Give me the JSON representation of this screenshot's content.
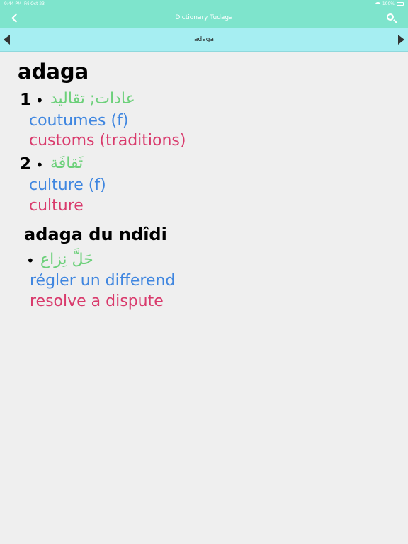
{
  "status_bar": {
    "time": "9:44 PM",
    "date": "Fri Oct 23",
    "battery": "100%"
  },
  "nav": {
    "title": "Dictionary Tudaga"
  },
  "sub_nav": {
    "title": "adaga"
  },
  "entry": {
    "headword": "adaga",
    "senses": [
      {
        "number": "1",
        "bullet": "•",
        "arabic": "عادات; تقاليد",
        "french": "coutumes (f)",
        "english": "customs (traditions)"
      },
      {
        "number": "2",
        "bullet": "•",
        "arabic": "ثَقافَة",
        "french": "culture (f)",
        "english": "culture"
      }
    ],
    "phrase": {
      "title": "adaga du ndîdi",
      "bullet": "•",
      "arabic": "حَلَّ نِزاع",
      "french": "régler un differend",
      "english": "resolve a dispute"
    }
  },
  "colors": {
    "nav_bg": "#7ee4cc",
    "sub_nav_bg": "#a6eef2",
    "arabic": "#6cd07a",
    "french": "#3f86e0",
    "english": "#d93a6c"
  },
  "icons": {
    "back": "chevron-left-icon",
    "search": "search-icon",
    "prev": "triangle-left-icon",
    "next": "triangle-right-icon"
  }
}
